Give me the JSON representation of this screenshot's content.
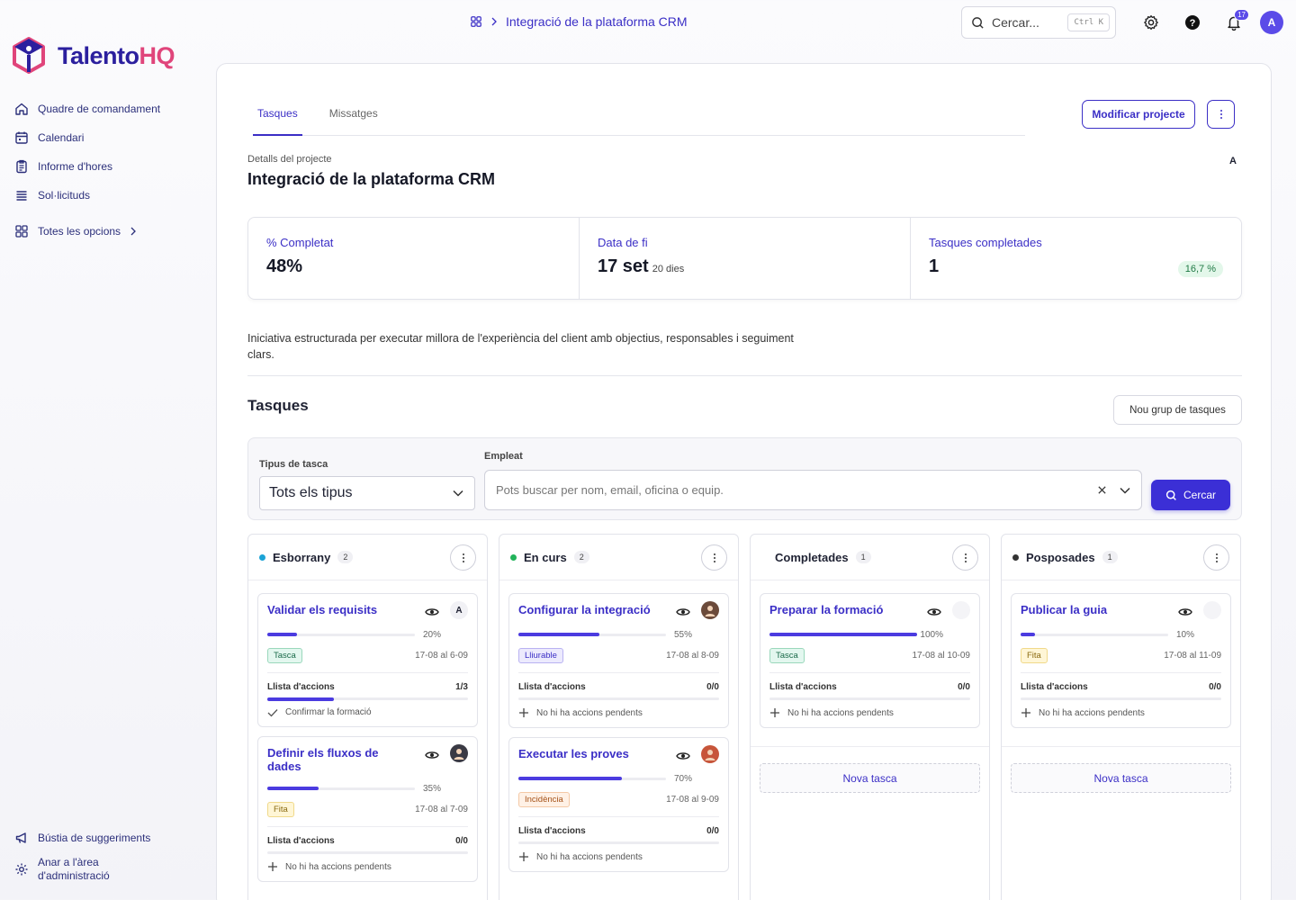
{
  "brand": {
    "name_main": "Talento",
    "name_accent": "HQ"
  },
  "sidebar": {
    "items": [
      {
        "label": "Quadre de comandament",
        "icon": "home-icon"
      },
      {
        "label": "Calendari",
        "icon": "calendar-icon"
      },
      {
        "label": "Informe d'hores",
        "icon": "clipboard-icon"
      },
      {
        "label": "Sol·licituds",
        "icon": "list-icon"
      }
    ],
    "all_options": "Totes les opcions",
    "bottom": [
      {
        "label": "Bústia de suggeriments",
        "icon": "megaphone-icon"
      },
      {
        "label": "Anar a l'àrea d'administració",
        "icon": "gear-icon"
      }
    ]
  },
  "topbar": {
    "breadcrumb": "Integració de la plataforma CRM",
    "search_placeholder": "Cercar...",
    "shortcut": "Ctrl K",
    "notifications_count": "17",
    "avatar_initial": "A"
  },
  "main": {
    "tabs": [
      {
        "label": "Tasques",
        "active": true
      },
      {
        "label": "Missatges",
        "active": false
      }
    ],
    "edit_button": "Modificar projecte",
    "section_label": "Detalls del projecte",
    "title": "Integració de la plataforma CRM",
    "owner_initial": "A",
    "stats": {
      "completed_label": "% Completat",
      "completed_value": "48%",
      "end_label": "Data de fi",
      "end_value": "17 set",
      "end_sub": "20 dies",
      "tasks_label": "Tasques completades",
      "tasks_value": "1",
      "tasks_badge": "16,7 %"
    },
    "description": "Iniciativa estructurada per executar millora de l'experiència del client amb objectius, responsables i seguiment clars.",
    "tasks_title": "Tasques",
    "new_group_button": "Nou grup de tasques",
    "filters": {
      "type_label": "Tipus de tasca",
      "type_value": "Tots els tipus",
      "employee_label": "Empleat",
      "employee_placeholder": "Pots buscar per nom, email, oficina o equip.",
      "search_button": "Cercar"
    }
  },
  "colors": {
    "accent": "#3b2fc6",
    "draft": "#1ba3d6",
    "progress": "#22b35a",
    "paused": "#333333"
  },
  "columns": [
    {
      "name": "Esborrany",
      "count": "2",
      "dot_color": "#1ba3d6",
      "cards": [
        {
          "title": "Validar els requisits",
          "progress": 20,
          "progress_label": "20%",
          "tag": "Tasca",
          "tag_style": "green",
          "dates": "17-08 al 6-09",
          "avatar": "A",
          "actions_label": "Llista d'accions",
          "actions_count": "1/3",
          "actions_progress": 33,
          "action_icon": "check-icon",
          "action_text": "Confirmar la formació"
        },
        {
          "title": "Definir els fluxos de dades",
          "progress": 35,
          "progress_label": "35%",
          "tag": "Fita",
          "tag_style": "yellow",
          "dates": "17-08 al 7-09",
          "avatar": "",
          "actions_label": "Llista d'accions",
          "actions_count": "0/0",
          "actions_progress": 0,
          "action_icon": "plus-icon",
          "action_text": "No hi ha accions pendents"
        }
      ]
    },
    {
      "name": "En curs",
      "count": "2",
      "dot_color": "#22b35a",
      "cards": [
        {
          "title": "Configurar la integració",
          "progress": 55,
          "progress_label": "55%",
          "tag": "Lliurable",
          "tag_style": "blue",
          "dates": "17-08 al 8-09",
          "avatar": "",
          "actions_label": "Llista d'accions",
          "actions_count": "0/0",
          "actions_progress": 0,
          "action_icon": "plus-icon",
          "action_text": "No hi ha accions pendents"
        },
        {
          "title": "Executar les proves",
          "progress": 70,
          "progress_label": "70%",
          "tag": "Incidència",
          "tag_style": "orange",
          "dates": "17-08 al 9-09",
          "avatar": "",
          "actions_label": "Llista d'accions",
          "actions_count": "0/0",
          "actions_progress": 0,
          "action_icon": "plus-icon",
          "action_text": "No hi ha accions pendents"
        }
      ]
    },
    {
      "name": "Completades",
      "count": "1",
      "dot_color": "#ffffff",
      "cards": [
        {
          "title": "Preparar la formació",
          "progress": 100,
          "progress_label": "100%",
          "tag": "Tasca",
          "tag_style": "green",
          "dates": "17-08 al 10-09",
          "avatar": "",
          "actions_label": "Llista d'accions",
          "actions_count": "0/0",
          "actions_progress": 0,
          "action_icon": "plus-icon",
          "action_text": "No hi ha accions pendents"
        }
      ],
      "new_task": "Nova tasca"
    },
    {
      "name": "Posposades",
      "count": "1",
      "dot_color": "#333333",
      "cards": [
        {
          "title": "Publicar la guia",
          "progress": 10,
          "progress_label": "10%",
          "tag": "Fita",
          "tag_style": "yellow",
          "dates": "17-08 al 11-09",
          "avatar": "",
          "actions_label": "Llista d'accions",
          "actions_count": "0/0",
          "actions_progress": 0,
          "action_icon": "plus-icon",
          "action_text": "No hi ha accions pendents"
        }
      ],
      "new_task": "Nova tasca"
    }
  ]
}
